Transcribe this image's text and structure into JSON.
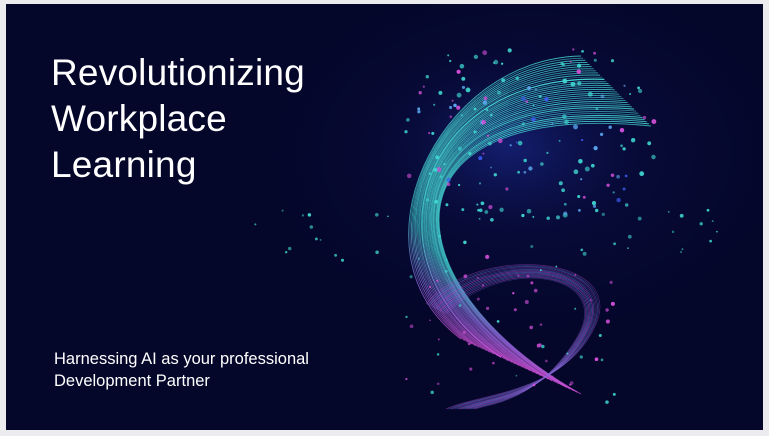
{
  "slide": {
    "title_lines": [
      "Revolutionizing",
      "Workplace",
      "Learning"
    ],
    "subtitle_lines": [
      "Harnessing AI as your professional",
      "Development Partner"
    ],
    "background_color": "#04062a",
    "text_color": "#ffffff",
    "accent_colors": [
      "#3fd6d0",
      "#d24fd8",
      "#3a5cf0"
    ]
  }
}
